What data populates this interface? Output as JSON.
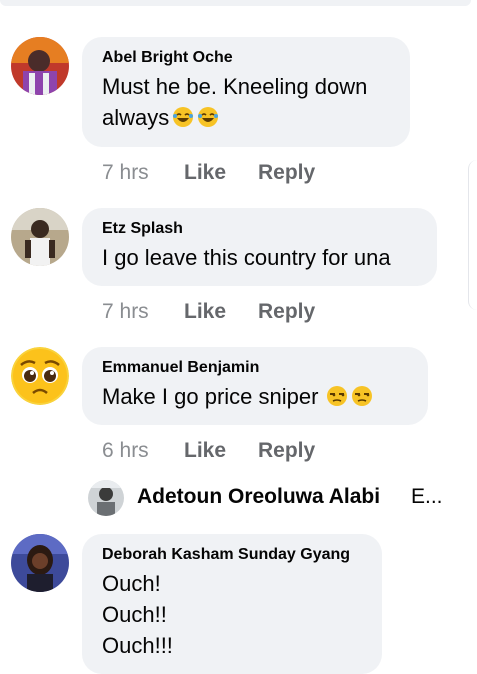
{
  "comments": [
    {
      "author": "Abel Bright Oche",
      "line1": "Must he be. Kneeling down",
      "line2": "always",
      "emojis": [
        "rolling-on-floor-laughing-icon",
        "rolling-on-floor-laughing-icon"
      ],
      "time": "7 hrs",
      "like": "Like",
      "reply": "Reply"
    },
    {
      "author": "Etz Splash",
      "line1": "I go leave this country for una",
      "time": "7 hrs",
      "like": "Like",
      "reply": "Reply"
    },
    {
      "author": "Emmanuel Benjamin",
      "line1": "Make I go price sniper",
      "emojis": [
        "unamused-face-icon",
        "unamused-face-icon"
      ],
      "time": "6 hrs",
      "like": "Like",
      "reply": "Reply"
    },
    {
      "author": "Deborah Kasham Sunday Gyang",
      "line1": "Ouch!",
      "line2": "Ouch!!",
      "line3": "Ouch!!!"
    }
  ],
  "reply_preview": {
    "author": "Adetoun Oreoluwa Alabi",
    "snippet": "E..."
  },
  "colors": {
    "bubble": "#f0f2f5",
    "meta_text": "#65676b",
    "text": "#050505"
  }
}
